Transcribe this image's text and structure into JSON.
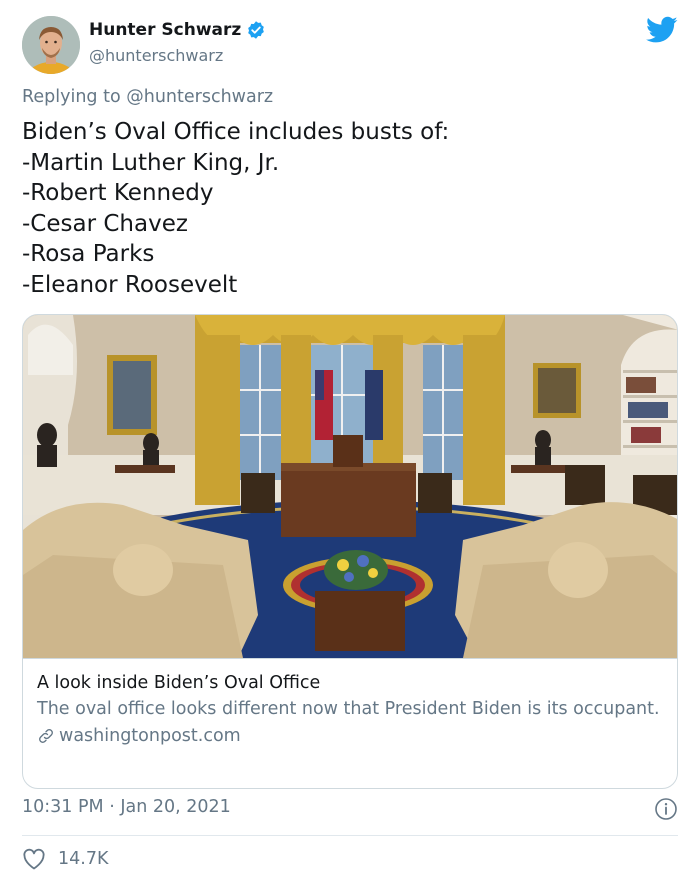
{
  "author": {
    "name": "Hunter Schwarz",
    "handle": "@hunterschwarz",
    "verified": true
  },
  "reply": {
    "prefix": "Replying to",
    "to_handle": "@hunterschwarz"
  },
  "tweet": {
    "text": "Biden’s Oval Office includes busts of:\n-Martin Luther King, Jr.\n-Robert Kennedy\n-Cesar Chavez\n-Rosa Parks\n-Eleanor Roosevelt"
  },
  "card": {
    "title": "A look inside Biden’s Oval Office",
    "description": "The oval office looks different now that President Biden is its occupant.",
    "domain": "washingtonpost.com"
  },
  "meta": {
    "timestamp": "10:31 PM · Jan 20, 2021",
    "likes": "14.7K"
  },
  "colors": {
    "twitter_blue": "#1da1f2",
    "secondary_text": "#657786",
    "primary_text": "#14171a",
    "border": "#cfd9de"
  },
  "icons": {
    "logo": "twitter-bird-icon",
    "verified": "verified-badge-icon",
    "link": "link-icon",
    "info": "info-icon",
    "like": "heart-icon"
  }
}
